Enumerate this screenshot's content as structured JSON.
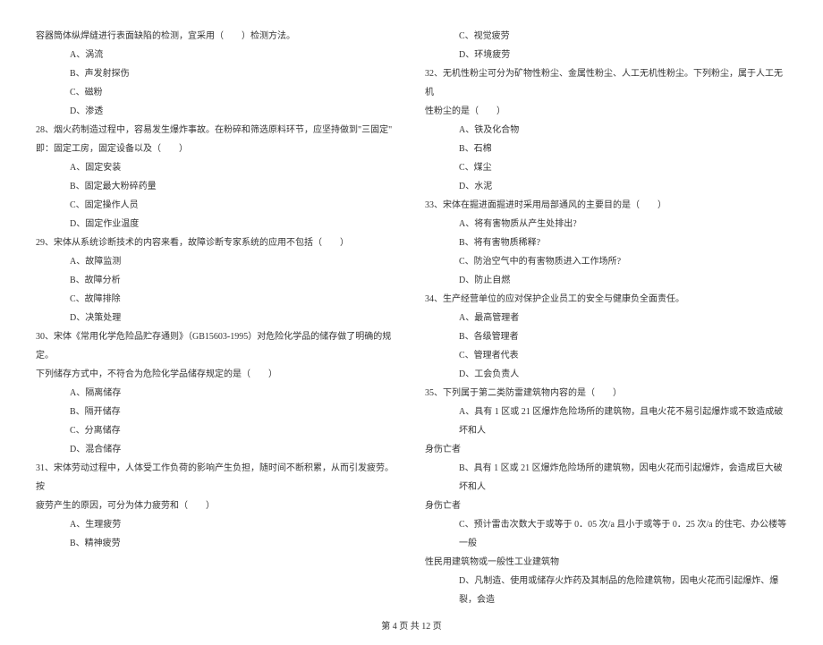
{
  "left": [
    {
      "cls": "indent1",
      "text": "容器筒体纵焊缝进行表面缺陷的检测，宜采用（　　）检测方法。"
    },
    {
      "cls": "indent2",
      "text": "A、涡流"
    },
    {
      "cls": "indent2",
      "text": "B、声发射探伤"
    },
    {
      "cls": "indent2",
      "text": "C、磁粉"
    },
    {
      "cls": "indent2",
      "text": "D、渗透"
    },
    {
      "cls": "indent1",
      "text": "28、烟火药制造过程中，容易发生爆炸事故。在粉碎和筛选原料环节，应坚持做到\"三固定\""
    },
    {
      "cls": "indent1",
      "text": "即：固定工房，固定设备以及（　　）"
    },
    {
      "cls": "indent2",
      "text": "A、固定安装"
    },
    {
      "cls": "indent2",
      "text": "B、固定最大粉碎药量"
    },
    {
      "cls": "indent2",
      "text": "C、固定操作人员"
    },
    {
      "cls": "indent2",
      "text": "D、固定作业温度"
    },
    {
      "cls": "indent1",
      "text": "29、宋体从系统诊断技术的内容来看，故障诊断专家系统的应用不包括（　　）"
    },
    {
      "cls": "indent2",
      "text": "A、故障监测"
    },
    {
      "cls": "indent2",
      "text": "B、故障分析"
    },
    {
      "cls": "indent2",
      "text": "C、故障排除"
    },
    {
      "cls": "indent2",
      "text": "D、决策处理"
    },
    {
      "cls": "indent1",
      "text": "30、宋体《常用化学危险品贮存通则》（GB15603-1995）对危险化学品的储存做了明确的规定。"
    },
    {
      "cls": "indent1",
      "text": "下列储存方式中，不符合为危险化学品储存规定的是（　　）"
    },
    {
      "cls": "indent2",
      "text": "A、隔离储存"
    },
    {
      "cls": "indent2",
      "text": "B、隔开储存"
    },
    {
      "cls": "indent2",
      "text": "C、分离储存"
    },
    {
      "cls": "indent2",
      "text": "D、混合储存"
    },
    {
      "cls": "indent1",
      "text": "31、宋体劳动过程中，人体受工作负荷的影响产生负担，随时间不断积累，从而引发疲劳。按"
    },
    {
      "cls": "indent1",
      "text": "疲劳产生的原因，可分为体力疲劳和（　　）"
    },
    {
      "cls": "indent2",
      "text": "A、生理疲劳"
    },
    {
      "cls": "indent2",
      "text": "B、精神疲劳"
    }
  ],
  "right": [
    {
      "cls": "indent2",
      "text": "C、视觉疲劳"
    },
    {
      "cls": "indent2",
      "text": "D、环境疲劳"
    },
    {
      "cls": "indent1",
      "text": "32、无机性粉尘可分为矿物性粉尘、金属性粉尘、人工无机性粉尘。下列粉尘，属于人工无机"
    },
    {
      "cls": "indent1",
      "text": "性粉尘的是（　　）"
    },
    {
      "cls": "indent2",
      "text": "A、铁及化合物"
    },
    {
      "cls": "indent2",
      "text": "B、石棉"
    },
    {
      "cls": "indent2",
      "text": "C、煤尘"
    },
    {
      "cls": "indent2",
      "text": "D、水泥"
    },
    {
      "cls": "indent1",
      "text": "33、宋体在掘进面掘进时采用局部通风的主要目的是（　　）"
    },
    {
      "cls": "indent2",
      "text": "A、将有害物质从产生处排出?"
    },
    {
      "cls": "indent2",
      "text": "B、将有害物质稀释?"
    },
    {
      "cls": "indent2",
      "text": "C、防治空气中的有害物质进入工作场所?"
    },
    {
      "cls": "indent2",
      "text": "D、防止自燃"
    },
    {
      "cls": "indent1",
      "text": "34、生产经营单位的应对保护企业员工的安全与健康负全面责任。"
    },
    {
      "cls": "indent2",
      "text": "A、最高管理者"
    },
    {
      "cls": "indent2",
      "text": "B、各级管理者"
    },
    {
      "cls": "indent2",
      "text": "C、管理者代表"
    },
    {
      "cls": "indent2",
      "text": "D、工会负责人"
    },
    {
      "cls": "indent1",
      "text": "35、下列属于第二类防雷建筑物内容的是（　　）"
    },
    {
      "cls": "indent2",
      "text": "A、具有 1 区或 21 区爆炸危险场所的建筑物，且电火花不易引起爆炸或不致造成破坏和人"
    },
    {
      "cls": "indent1",
      "text": "身伤亡者"
    },
    {
      "cls": "indent2",
      "text": "B、具有 1 区或 21 区爆炸危险场所的建筑物，因电火花而引起爆炸，会造成巨大破坏和人"
    },
    {
      "cls": "indent1",
      "text": "身伤亡者"
    },
    {
      "cls": "indent2",
      "text": "C、预计雷击次数大于或等于 0．05 次/a 且小于或等于 0．25 次/a 的住宅、办公楼等一般"
    },
    {
      "cls": "indent1",
      "text": "性民用建筑物或一般性工业建筑物"
    },
    {
      "cls": "indent2",
      "text": "D、凡制造、使用或储存火炸药及其制品的危险建筑物，因电火花而引起爆炸、爆裂，会造"
    }
  ],
  "footer": "第 4 页 共 12 页"
}
